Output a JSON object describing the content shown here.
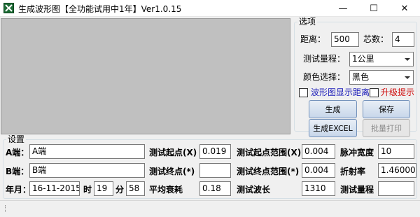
{
  "window": {
    "title": "生成波形图【全功能试用中1年】Ver1.0.15",
    "minimize": "—",
    "maximize": "☐",
    "close": "✕"
  },
  "options": {
    "legend": "选项",
    "distance_label": "距离：",
    "distance_value": "500",
    "cores_label": "芯数：",
    "cores_value": "4",
    "range_label": "测试量程：",
    "range_value": "1公里",
    "color_label": "颜色选择：",
    "color_value": "黑色",
    "show_distance_label": "波形图显示距离",
    "upgrade_label": "升级提示",
    "buttons": {
      "generate": "生成",
      "save": "保存",
      "generate_excel": "生成EXCEL",
      "batch_print": "批量打印"
    }
  },
  "settings": {
    "legend": "设置",
    "a_end_label": "A端：",
    "a_end_value": "A端",
    "b_end_label": "B端：",
    "b_end_value": "B端",
    "date_label": "年月：",
    "date_value": "16-11-2015",
    "hour_label": "时",
    "hour_value": "19",
    "minute_label": "分",
    "minute_value": "58",
    "test_start_label": "测试起点(X)",
    "test_start_value": "0.019",
    "test_end_label": "测试终点(*)",
    "test_end_value": "",
    "avg_loss_label": "平均衰耗",
    "avg_loss_value": "0.18",
    "start_range_label": "测试起点范围(X)",
    "start_range_value": "0.004",
    "end_range_label": "测试终点范围(*)",
    "end_range_value": "0.004",
    "wavelength_label": "测试波长",
    "wavelength_value": "1310",
    "pulse_width_label": "脉冲宽度",
    "pulse_width_value": "10",
    "refractive_label": "折射率",
    "refractive_value": "1.460000",
    "test_range_label": "测试量程",
    "test_range_value": ""
  },
  "status": {
    "text": ""
  }
}
